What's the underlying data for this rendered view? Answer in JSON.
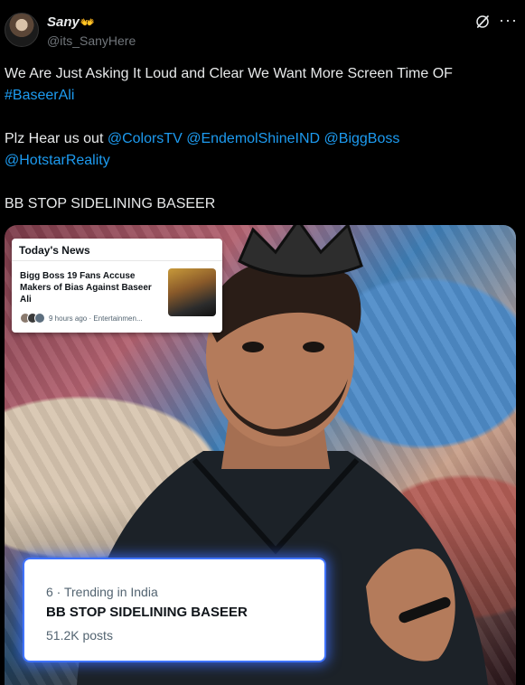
{
  "tweet": {
    "author": {
      "display_name": "Sany",
      "name_emoji": "👐",
      "handle": "@its_SanyHere"
    },
    "lines": {
      "l1": "We Are Just Asking It Loud and Clear We Want More Screen Time OF",
      "l2_hashtag": "#BaseerAli",
      "l3_prefix": "Plz Hear us out ",
      "mention1": "@ColorsTV",
      "mention2": "@EndemolShineIND",
      "mention3": "@BiggBoss",
      "mention4": "@HotstarReality",
      "l5": "BB STOP SIDELINING BASEER"
    },
    "icons": {
      "grok": "grok-icon",
      "more": "more-icon"
    }
  },
  "media": {
    "news_card": {
      "heading": "Today's News",
      "title": "Bigg Boss 19 Fans Accuse Makers of Bias Against Baseer Ali",
      "meta": "9 hours ago · Entertainmen..."
    },
    "trend_card": {
      "rank": "6 · Trending in India",
      "title": "BB STOP SIDELINING BASEER",
      "posts": "51.2K posts"
    }
  },
  "colors": {
    "background": "#000000",
    "text": "#e7e9ea",
    "secondary_text": "#71767b",
    "link": "#1d9bf0",
    "trend_glow": "#3f73ff"
  }
}
